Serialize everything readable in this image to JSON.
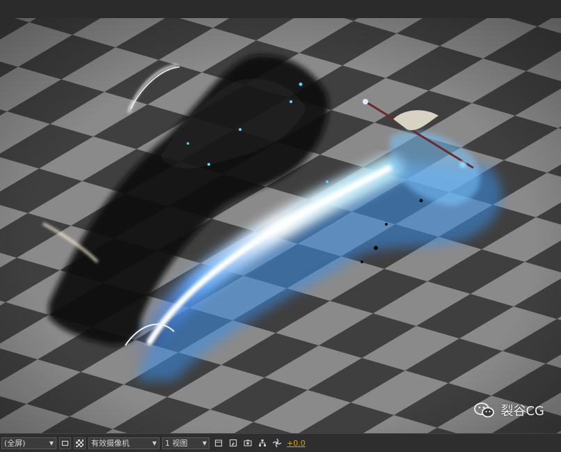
{
  "viewport": {
    "checker_light": "#8a8a8a",
    "checker_dark": "#3f3f3f",
    "effect": "blue-lightning-dragon-with-dark-smoke"
  },
  "watermark": {
    "text": "裂谷CG",
    "icon": "wechat-icon"
  },
  "statusbar": {
    "magnification": "(全屏)",
    "camera": "有效摄像机",
    "views": "1 视图",
    "exposure": "+0.0",
    "exposure_color": "#d9a400",
    "icons": [
      "region-of-interest-icon",
      "transparency-grid-icon",
      "timeline-icon",
      "draft-3d-icon",
      "snapshot-icon",
      "flowchart-icon",
      "reset-exposure-icon"
    ]
  }
}
